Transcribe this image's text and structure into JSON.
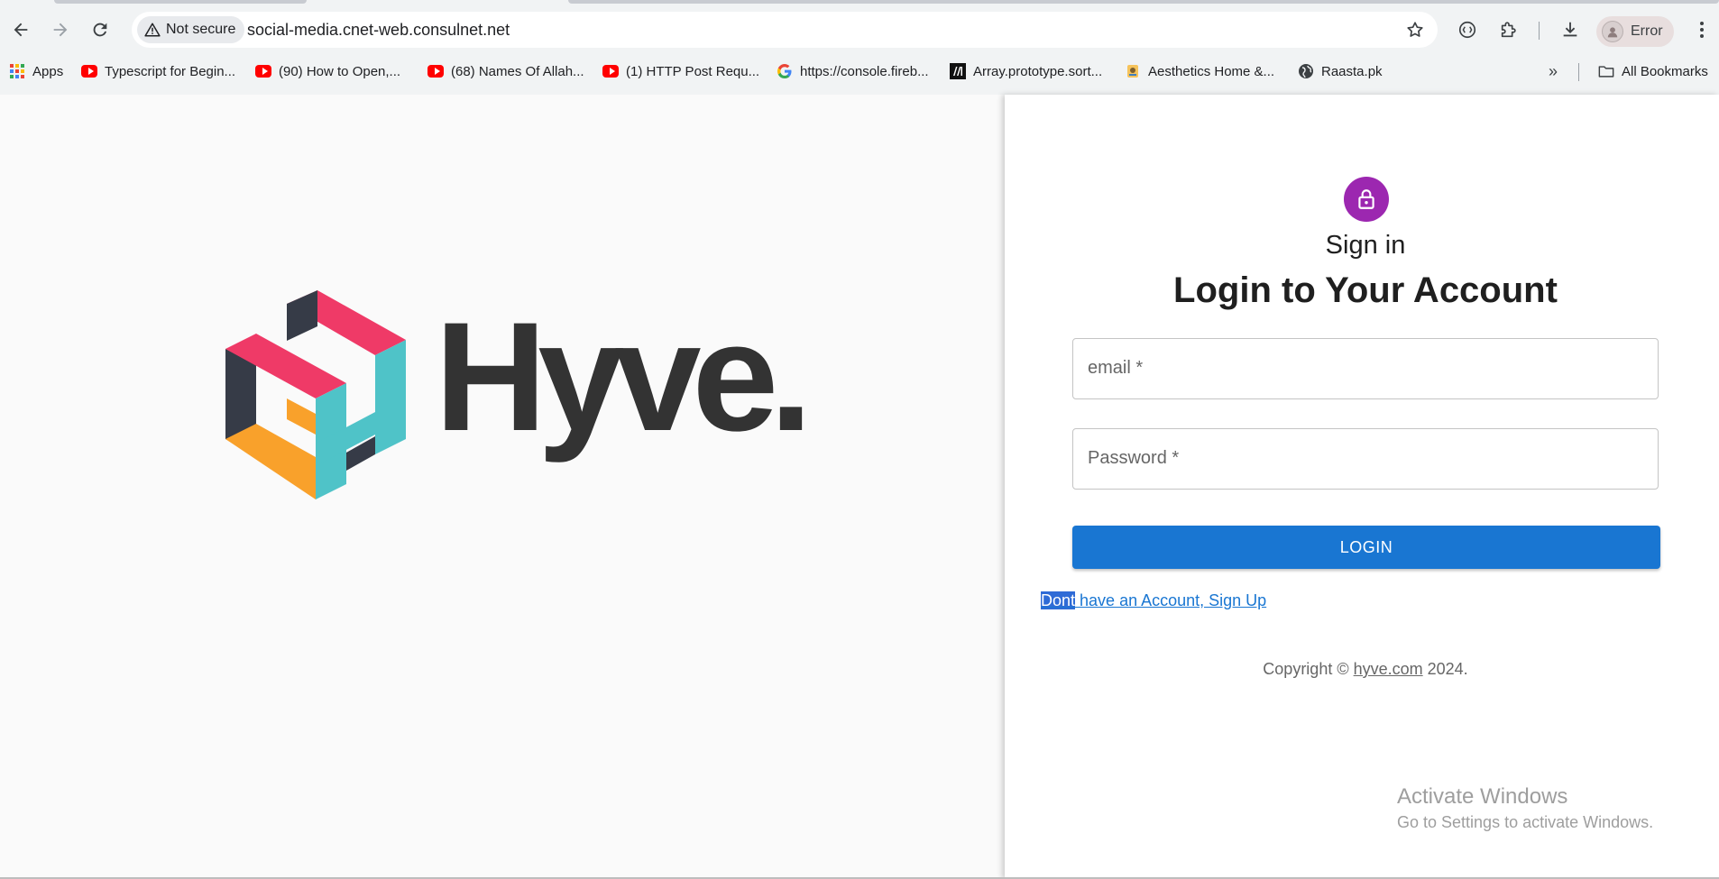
{
  "browser": {
    "security_label": "Not secure",
    "url": "social-media.cnet-web.consulnet.net",
    "profile_label": "Error",
    "bookmarks": [
      {
        "label": "Apps",
        "icon": "apps-grid-icon"
      },
      {
        "label": "Typescript for Begin...",
        "icon": "youtube-icon"
      },
      {
        "label": "(90) How to Open,...",
        "icon": "youtube-icon"
      },
      {
        "label": "(68) Names Of Allah...",
        "icon": "youtube-icon"
      },
      {
        "label": "(1) HTTP Post Requ...",
        "icon": "youtube-icon"
      },
      {
        "label": "https://console.fireb...",
        "icon": "google-icon"
      },
      {
        "label": "Array.prototype.sort...",
        "icon": "mdn-icon"
      },
      {
        "label": "Aesthetics Home &...",
        "icon": "aesthetics-site-icon"
      },
      {
        "label": "Raasta.pk",
        "icon": "globe-icon"
      }
    ],
    "all_bookmarks_label": "All Bookmarks"
  },
  "brand": {
    "name": "Hyve."
  },
  "login": {
    "subtitle": "Sign in",
    "title": "Login to Your Account",
    "email_label": "email *",
    "password_label": "Password *",
    "login_button": "LOGIN",
    "signup_selected": "Dont",
    "signup_rest": " have an Account, Sign Up",
    "copyright_prefix": "Copyright © ",
    "copyright_link": "hyve.com",
    "copyright_suffix": " 2024."
  },
  "watermark": {
    "title": "Activate Windows",
    "subtitle": "Go to Settings to activate Windows."
  },
  "colors": {
    "primary": "#1976d2",
    "avatar_purple": "#9c27b0",
    "logo_pink": "#ef3a67",
    "logo_dark": "#363b47",
    "logo_orange": "#f9a12b",
    "logo_teal": "#4fc3c8"
  }
}
